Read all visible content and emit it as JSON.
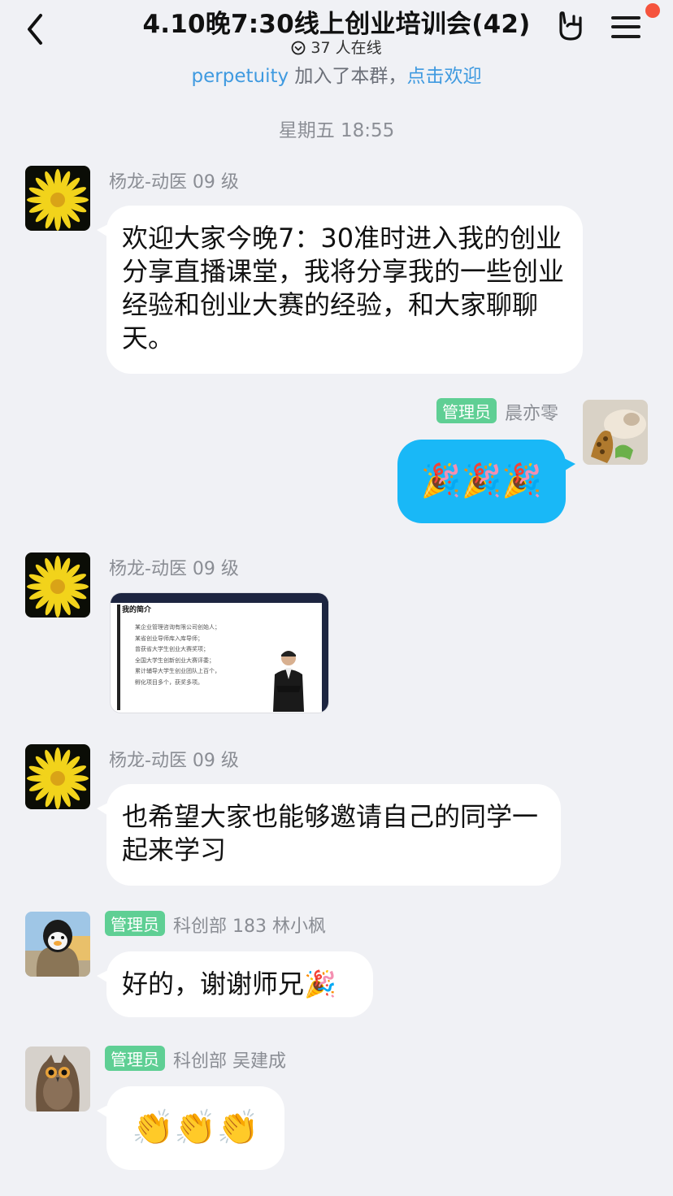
{
  "header": {
    "title": "4.10晚7:30线上创业培训会(42)",
    "online": "37 人在线",
    "join_name": "perpetuity",
    "join_text": " 加入了本群，",
    "join_action": "点击欢迎"
  },
  "timestamp": "星期五 18:55",
  "messages": [
    {
      "sender": "杨龙-动医 09 级",
      "text": "欢迎大家今晚7：30准时进入我的创业分享直播课堂，我将分享我的一些创业经验和创业大赛的经验，和大家聊聊天。"
    },
    {
      "tag": "管理员",
      "sender": "晨亦零",
      "emoji": "🎉🎉🎉"
    },
    {
      "sender": "杨龙-动医 09 级",
      "image_title": "我的简介",
      "image_lines": [
        "某企业管理咨询有限公司创始人；",
        "某省创业导师库入库导师；",
        "曾获省大学生创业大赛奖项；",
        "全国大学生创新创业大赛评委；",
        "累计辅导大学生创业团队上百个，",
        "孵化项目多个，获奖多项。"
      ]
    },
    {
      "sender": "杨龙-动医 09 级",
      "text": "也希望大家也能够邀请自己的同学一起来学习"
    },
    {
      "tag": "管理员",
      "sender": "科创部 183 林小枫",
      "text": "好的，谢谢师兄🎉"
    },
    {
      "tag": "管理员",
      "sender": "科创部 吴建成",
      "emoji": "👏👏👏"
    }
  ],
  "colors": {
    "accent": "#19b8f7",
    "admin_tag": "#5fcf94",
    "link": "#3f9ae0",
    "notify": "#f5533d"
  }
}
